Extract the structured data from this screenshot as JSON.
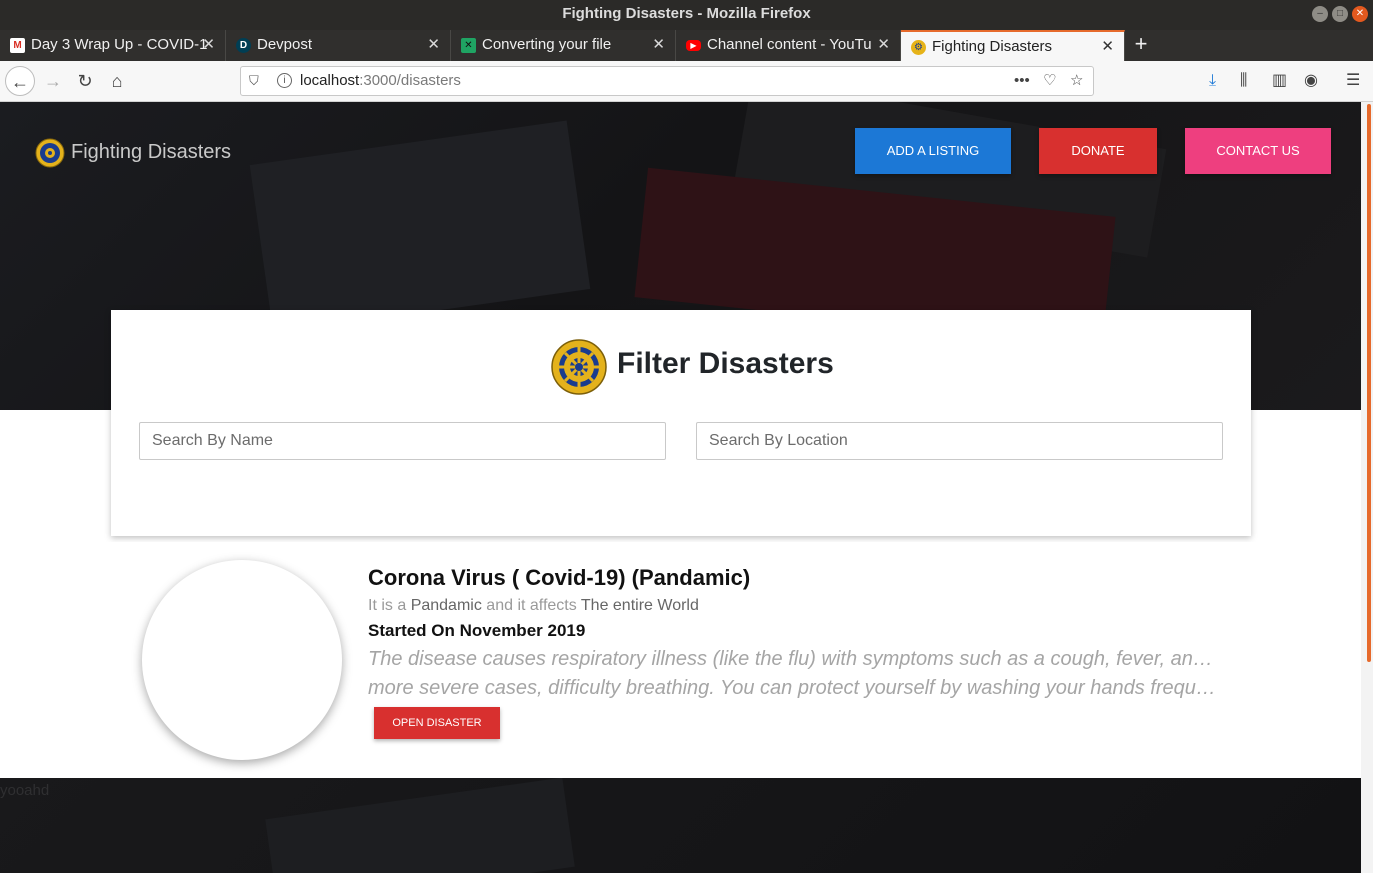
{
  "window": {
    "title": "Fighting Disasters - Mozilla Firefox"
  },
  "tabs": [
    {
      "label": "Day 3 Wrap Up - COVID-1",
      "icon": "gmail-icon"
    },
    {
      "label": "Devpost",
      "icon": "devpost-icon"
    },
    {
      "label": "Converting your file",
      "icon": "converter-icon"
    },
    {
      "label": "Channel content - YouTu",
      "icon": "youtube-icon"
    },
    {
      "label": "Fighting Disasters",
      "icon": "rotary-icon"
    }
  ],
  "urlbar": {
    "host": "localhost",
    "path": ":3000/disasters"
  },
  "site": {
    "brand": "Fighting Disasters",
    "buttons": {
      "add": "ADD A LISTING",
      "donate": "DONATE",
      "contact": "CONTACT US"
    }
  },
  "filter": {
    "title": "Filter Disasters",
    "name_placeholder": "Search By Name",
    "location_placeholder": "Search By Location"
  },
  "listing": {
    "title": "Corona Virus ( Covid-19) (Pandamic)",
    "meta_prefix": "It is a",
    "type": "Pandamic",
    "meta_mid": "and it affects",
    "affects": "The entire World",
    "started": "Started On November 2019",
    "desc_line1": "The disease causes respiratory illness (like the flu) with symptoms such as a cough, fever, and in",
    "desc_line2": "more severe cases, difficulty breathing. You can protect yourself by washing your hands frequently,...",
    "button": "OPEN DISASTER"
  },
  "footer": {
    "text": "yooahd"
  },
  "colors": {
    "add": "#1c78d6",
    "donate": "#d8302f",
    "contact": "#ee3f7f",
    "accent_tab": "#e66a2c"
  }
}
